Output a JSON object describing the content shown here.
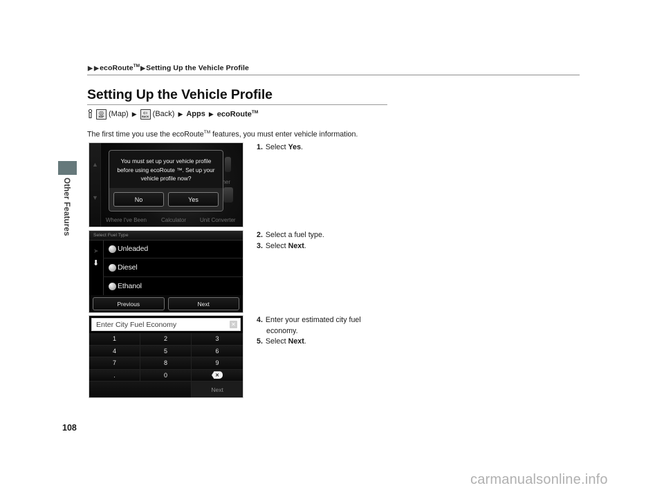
{
  "breadcrumb": {
    "arrow": "▶",
    "parent": "ecoRoute",
    "parent_tm": "TM",
    "current": "Setting Up the Vehicle Profile"
  },
  "page_title": "Setting Up the Vehicle Profile",
  "nav_path": {
    "hand_icon": "hand-pointer-icon",
    "map_button_label": "MAP",
    "map_text": "(Map)",
    "back_button_label": "BACK",
    "back_text": "(Back)",
    "apps_text": "Apps",
    "ecoroute_text": "ecoRoute",
    "ecoroute_tm": "TM",
    "arrow": "▶"
  },
  "intro": {
    "part1": "The first time you use the ecoRoute",
    "tm": "TM",
    "part2": " features, you must enter vehicle information."
  },
  "side_tab": {
    "label": "Other Features",
    "color": "#66797b"
  },
  "page_number": "108",
  "watermark": "carmanualsonline.info",
  "screenshots": {
    "shot1": {
      "name": "vehicle-profile-confirmation-dialog",
      "dialog_message": "You must set up your vehicle profile before using ecoRoute ™. Set up your vehicle profile now?",
      "button_no": "No",
      "button_yes": "Yes",
      "background_apps": [
        "Where I've Been",
        "Calculator",
        "Unit Converter",
        "nner"
      ]
    },
    "shot2": {
      "name": "select-fuel-type-screen",
      "header": "Select Fuel Type",
      "options": [
        "Unleaded",
        "Diesel",
        "Ethanol"
      ],
      "button_previous": "Previous",
      "button_next": "Next",
      "scroll_up_icon": "chevron-up-icon",
      "scroll_down_icon": "arrow-down-icon"
    },
    "shot3": {
      "name": "enter-city-fuel-economy-keypad",
      "field_label": "Enter City Fuel Economy",
      "close_icon": "close-icon",
      "keys": [
        "1",
        "2",
        "3",
        "4",
        "5",
        "6",
        "7",
        "8",
        "9",
        ".",
        "0",
        "backspace-icon"
      ],
      "button_next": "Next"
    }
  },
  "steps": {
    "group1": [
      {
        "num": "1.",
        "pre": "Select ",
        "bold": "Yes",
        "post": "."
      }
    ],
    "group2": [
      {
        "num": "2.",
        "pre": "Select a fuel type.",
        "bold": "",
        "post": ""
      },
      {
        "num": "3.",
        "pre": "Select ",
        "bold": "Next",
        "post": "."
      }
    ],
    "group3": [
      {
        "num": "4.",
        "pre": "Enter your estimated city fuel",
        "bold": "",
        "post": "",
        "cont": "economy."
      },
      {
        "num": "5.",
        "pre": "Select ",
        "bold": "Next",
        "post": "."
      }
    ]
  }
}
